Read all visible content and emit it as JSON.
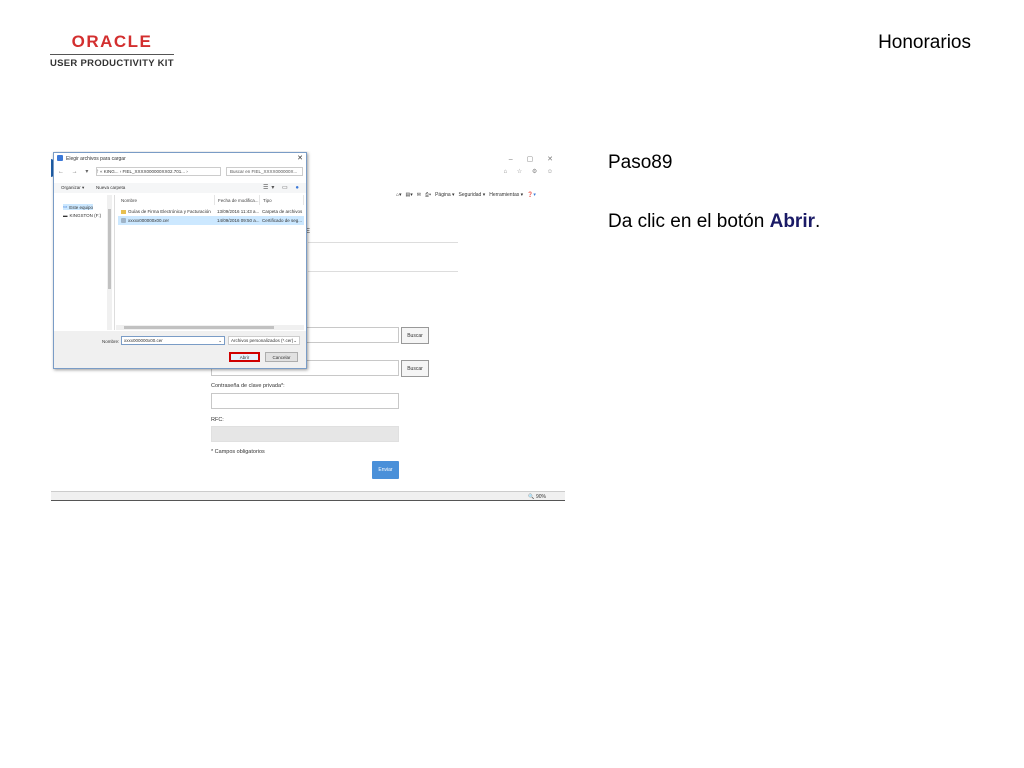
{
  "header": {
    "brand": "ORACLE",
    "product": "USER PRODUCTIVITY KIT",
    "title": "Honorarios"
  },
  "step": {
    "title": "Paso89",
    "instruction_prefix": "Da clic en el botón ",
    "instruction_bold": "Abrir",
    "instruction_suffix": "."
  },
  "browser": {
    "window_controls": "– ▢ ✕",
    "toolbar_icons": "⌂ ☆ ⚙ ☺",
    "menu_pagina": "Página ▾",
    "menu_seguridad": "Seguridad ▾",
    "menu_herramientas": "Herramientas ▾",
    "zoom": "🔍 90%",
    "bg_label_fragment": "E"
  },
  "form": {
    "buscar1": "Buscar",
    "buscar2": "Buscar",
    "password_label": "Contraseña de clave privada*:",
    "rfc_label": "RFC:",
    "required_note": "* Campos obligatorios",
    "send": "Enviar"
  },
  "dialog": {
    "title": "Elegir archivos para cargar",
    "close": "✕",
    "nav_arrows": "← → ▾ ↑",
    "path": "« KING... › FIEL_XXXX000000XX02.701... ›",
    "search_placeholder": "Buscar en FIEL_XXXX000000X...",
    "organize": "Organizar ▾",
    "new_folder": "Nueva carpeta",
    "tree": [
      {
        "label": "Este equipo"
      },
      {
        "label": "KINGSTON (F:)"
      }
    ],
    "columns": [
      "Nombre",
      "Fecha de modifica...",
      "Tipo"
    ],
    "files": [
      {
        "name": "Guías de Firma Electrónica y Facturación",
        "date": "13/09/2016 11:43 a...",
        "type": "Carpeta de archivos"
      },
      {
        "name": "xxxxx000000x00.cer",
        "date": "14/09/2016 09:50 a...",
        "type": "Certificado de seg..."
      }
    ],
    "filename_label": "Nombre:",
    "filename_value": "xxxx000000x00.cer",
    "filter": "Archivos personalizados (*.cer)",
    "open": "Abrir",
    "cancel": "Cancelar"
  }
}
